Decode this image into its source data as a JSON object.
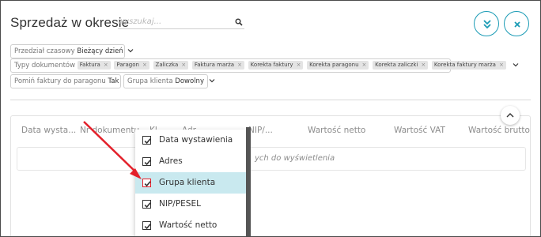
{
  "header": {
    "title": "Sprzedaż w okresie",
    "search_placeholder": "wyszukaj..."
  },
  "filters": {
    "period": {
      "label": "Przedział czasowy",
      "value": "Bieżący dzień"
    },
    "doc_types": {
      "label": "Typy dokumentów",
      "tags": [
        "Faktura",
        "Paragon",
        "Zaliczka",
        "Faktura marża",
        "Korekta faktury",
        "Korekta paragonu",
        "Korekta zaliczki",
        "Korekta faktury marża"
      ]
    },
    "skip_invoices": {
      "label": "Pomiń faktury do paragonu",
      "value": "Tak"
    },
    "client_group": {
      "label": "Grupa klienta",
      "value": "Dowolny"
    }
  },
  "table": {
    "columns": [
      "Data wysta...",
      "Nr dokumentu",
      "Kl...",
      "Adr...",
      "...",
      "NIP/...",
      "Wartość netto",
      "Wartość VAT",
      "Wartość brutto"
    ],
    "empty_message": "ych do wyświetlenia"
  },
  "column_menu": {
    "items": [
      {
        "label": "Data wystawienia",
        "checked": true
      },
      {
        "label": "Adres",
        "checked": true
      },
      {
        "label": "Grupa klienta",
        "checked": true
      },
      {
        "label": "NIP/PESEL",
        "checked": true
      },
      {
        "label": "Wartość netto",
        "checked": true
      }
    ],
    "highlighted_index": 2
  },
  "colors": {
    "accent": "#1a9bb5",
    "highlight": "#c9e9ef",
    "annotation_arrow": "#e3202a"
  },
  "icons": {
    "search": "search-icon",
    "collapse": "double-chevron-down-icon",
    "close": "close-icon",
    "scroll_up": "chevron-up-icon"
  }
}
